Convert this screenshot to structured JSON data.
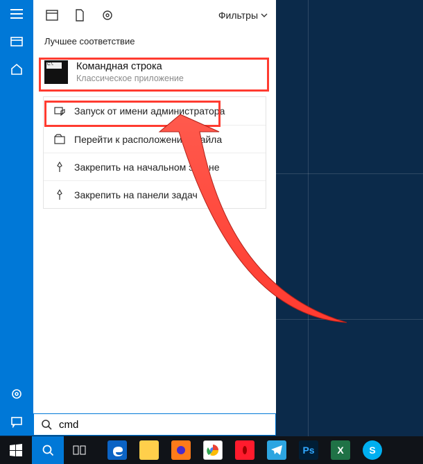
{
  "rail": {
    "items": [
      "menu",
      "recent",
      "home"
    ],
    "bottom": [
      "settings",
      "feedback"
    ]
  },
  "panel": {
    "top_icons": [
      "apps",
      "document",
      "settings"
    ],
    "filters_label": "Фильтры",
    "section_label": "Лучшее соответствие",
    "result": {
      "thumb_text": "C:\\.",
      "title": "Командная строка",
      "subtitle": "Классическое приложение"
    },
    "context": [
      {
        "icon": "run-admin",
        "label": "Запуск от имени администратора"
      },
      {
        "icon": "open-loc",
        "label": "Перейти к расположению файла"
      },
      {
        "icon": "pin-start",
        "label": "Закрепить на начальном экране"
      },
      {
        "icon": "pin-task",
        "label": "Закрепить на панели задач"
      }
    ]
  },
  "search": {
    "icon": "search",
    "query": "cmd"
  },
  "taskbar": {
    "items": [
      {
        "name": "start"
      },
      {
        "name": "search"
      },
      {
        "name": "taskview"
      },
      {
        "name": "edge"
      },
      {
        "name": "explorer"
      },
      {
        "name": "firefox"
      },
      {
        "name": "chrome"
      },
      {
        "name": "opera"
      },
      {
        "name": "telegram"
      },
      {
        "name": "photoshop",
        "label": "Ps"
      },
      {
        "name": "excel",
        "label": "X"
      },
      {
        "name": "skype",
        "label": "S"
      }
    ]
  },
  "colors": {
    "accent": "#0078d7",
    "highlight": "#ff3b30"
  }
}
